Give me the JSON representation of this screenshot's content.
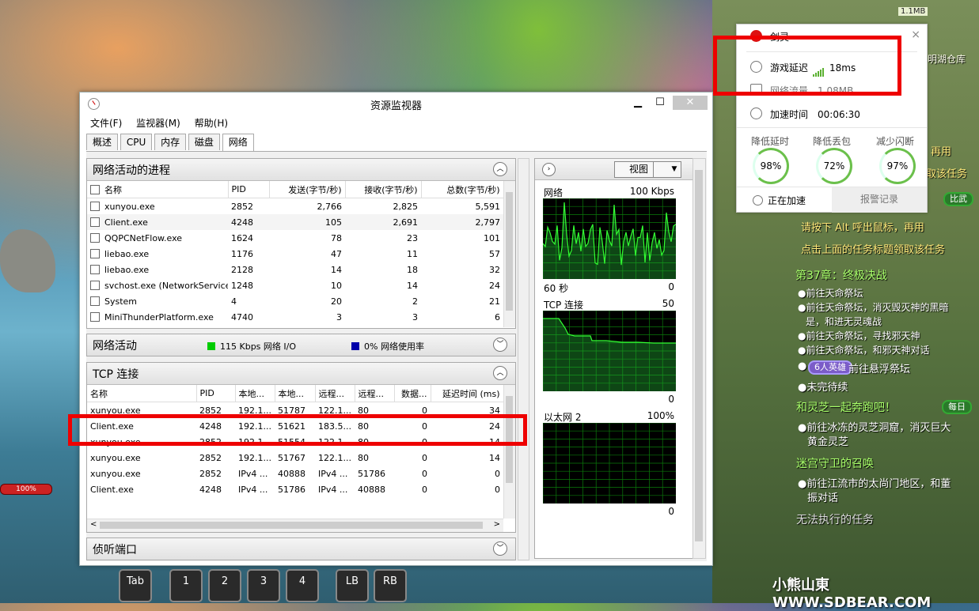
{
  "game": {
    "hud_top_size": "1.1MB",
    "map_label": "明湖仓库",
    "hp_bar": "100%",
    "quests": [
      {
        "text": "再用",
        "style": "gold"
      },
      {
        "text": "取该任务",
        "style": "gold"
      },
      {
        "text": "比武",
        "style": "badge"
      },
      {
        "text": "请按下 Alt 呼出鼠标，再用",
        "style": "gold"
      },
      {
        "text": "点击上面的任务标题领取该任务",
        "style": "gold"
      },
      {
        "text": "第37章：终极决战",
        "style": "green"
      },
      {
        "text": "●前往天命祭坛",
        "style": "white"
      },
      {
        "text": "●前往天命祭坛，消灭毁灭神的黑暗",
        "style": "white"
      },
      {
        "text": "是，和进无灵魂战",
        "style": "white"
      },
      {
        "text": "●前往天命祭坛，寻找邪天神",
        "style": "white"
      },
      {
        "text": "●前往天命祭坛，和邪天神对话",
        "style": "white"
      },
      {
        "text": "●",
        "style": "white"
      },
      {
        "text": "6人英雄",
        "style": "badge"
      },
      {
        "text": "前往悬浮祭坛",
        "style": "white"
      },
      {
        "text": "●未完待续",
        "style": "white"
      },
      {
        "text": "和灵芝一起奔跑吧！",
        "style": "green"
      },
      {
        "text": "每日",
        "style": "badge"
      },
      {
        "text": "●前往冰冻的灵芝洞窟，消灭巨大",
        "style": "white"
      },
      {
        "text": "黄金灵芝",
        "style": "white"
      },
      {
        "text": "迷宫守卫的召唤",
        "style": "green"
      },
      {
        "text": "●前往江流市的太尚门地区，和董",
        "style": "white"
      },
      {
        "text": "振对话",
        "style": "white"
      },
      {
        "text": "无法执行的任务",
        "style": "white"
      }
    ],
    "skills": [
      "Tab",
      "1",
      "2",
      "3",
      "4",
      "LB",
      "RB"
    ],
    "watermark": "小熊山東 WWW.SDBEAR.COM"
  },
  "xunyou": {
    "header": "剑灵",
    "latency_label": "游戏延迟",
    "latency_value": "18ms",
    "traffic_label": "网络流量",
    "traffic_value": "1.08MB",
    "time_label": "加速时间",
    "time_value": "00:06:30",
    "stats": [
      {
        "label": "降低延时",
        "value": "98%"
      },
      {
        "label": "降低丢包",
        "value": "72%"
      },
      {
        "label": "减少闪断",
        "value": "97%"
      }
    ],
    "status": "正在加速",
    "report_button": "报警记录",
    "close": "×"
  },
  "resmon": {
    "title": "资源监视器",
    "window_buttons": {
      "minimize": "▁",
      "maximize": "☐",
      "close": "✕"
    },
    "menu": [
      "文件(F)",
      "监视器(M)",
      "帮助(H)"
    ],
    "tabs": [
      "概述",
      "CPU",
      "内存",
      "磁盘",
      "网络"
    ],
    "active_tab": "网络",
    "processes": {
      "title": "网络活动的进程",
      "columns": [
        "名称",
        "PID",
        "发送(字节/秒)",
        "接收(字节/秒)",
        "总数(字节/秒)"
      ],
      "rows": [
        [
          "xunyou.exe",
          "2852",
          "2,766",
          "2,825",
          "5,591"
        ],
        [
          "Client.exe",
          "4248",
          "105",
          "2,691",
          "2,797"
        ],
        [
          "QQPCNetFlow.exe",
          "1624",
          "78",
          "23",
          "101"
        ],
        [
          "liebao.exe",
          "1176",
          "47",
          "11",
          "57"
        ],
        [
          "liebao.exe",
          "2128",
          "14",
          "18",
          "32"
        ],
        [
          "svchost.exe (NetworkService)",
          "1248",
          "10",
          "14",
          "24"
        ],
        [
          "System",
          "4",
          "20",
          "2",
          "21"
        ],
        [
          "MiniThunderPlatform.exe",
          "4740",
          "3",
          "3",
          "6"
        ]
      ]
    },
    "network_activity": {
      "title": "网络活动",
      "io_label": "115 Kbps 网络 I/O",
      "io_color": "#00cc00",
      "usage_label": "0% 网络使用率",
      "usage_color": "#0000aa"
    },
    "tcp": {
      "title": "TCP 连接",
      "columns": [
        "名称",
        "PID",
        "本地...",
        "本地...",
        "远程...",
        "远程...",
        "数据...",
        "延迟时间 (ms)"
      ],
      "rows": [
        [
          "xunyou.exe",
          "2852",
          "192.1...",
          "51787",
          "122.1...",
          "80",
          "0",
          "34"
        ],
        [
          "Client.exe",
          "4248",
          "192.1...",
          "51621",
          "183.5...",
          "80",
          "0",
          "24"
        ],
        [
          "xunyou.exe",
          "2852",
          "192.1...",
          "51554",
          "122.1...",
          "80",
          "0",
          "14"
        ],
        [
          "xunyou.exe",
          "2852",
          "192.1...",
          "51767",
          "122.1...",
          "80",
          "0",
          "14"
        ],
        [
          "xunyou.exe",
          "2852",
          "IPv4 ...",
          "40888",
          "IPv4 ...",
          "51786",
          "0",
          "0"
        ],
        [
          "Client.exe",
          "4248",
          "IPv4 ...",
          "51786",
          "IPv4 ...",
          "40888",
          "0",
          "0"
        ]
      ]
    },
    "listening": {
      "title": "侦听端口"
    },
    "side": {
      "view_label": "视图",
      "graphs": [
        {
          "name": "网络",
          "max": "100 Kbps",
          "footer_left": "60 秒",
          "footer_right": "0"
        },
        {
          "name": "TCP 连接",
          "max": "50",
          "footer_left": "",
          "footer_right": "0"
        },
        {
          "name": "以太网 2",
          "max": "100%",
          "footer_left": "",
          "footer_right": "0"
        }
      ]
    }
  }
}
